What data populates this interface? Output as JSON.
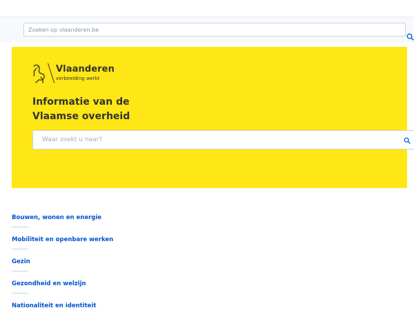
{
  "top_search": {
    "placeholder": "Zoeken op vlaanderen.be"
  },
  "logo": {
    "title": "Vlaanderen",
    "subtitle": "verbeelding werkt"
  },
  "hero": {
    "title_line1": "Informatie van de",
    "title_line2": "Vlaamse overheid",
    "search_placeholder": "Waar zoekt u naar?",
    "background_color": "#ffe615"
  },
  "themes": [
    {
      "label": "Bouwen, wonen en energie"
    },
    {
      "label": "Mobiliteit en openbare werken"
    },
    {
      "label": "Gezin"
    },
    {
      "label": "Gezondheid en welzijn"
    },
    {
      "label": "Nationaliteit en identiteit"
    }
  ],
  "colors": {
    "link": "#0055cc",
    "accent_yellow": "#ffe615",
    "text": "#333332"
  },
  "icons": {
    "search": "search-icon",
    "logo": "flemish-lion-icon"
  }
}
